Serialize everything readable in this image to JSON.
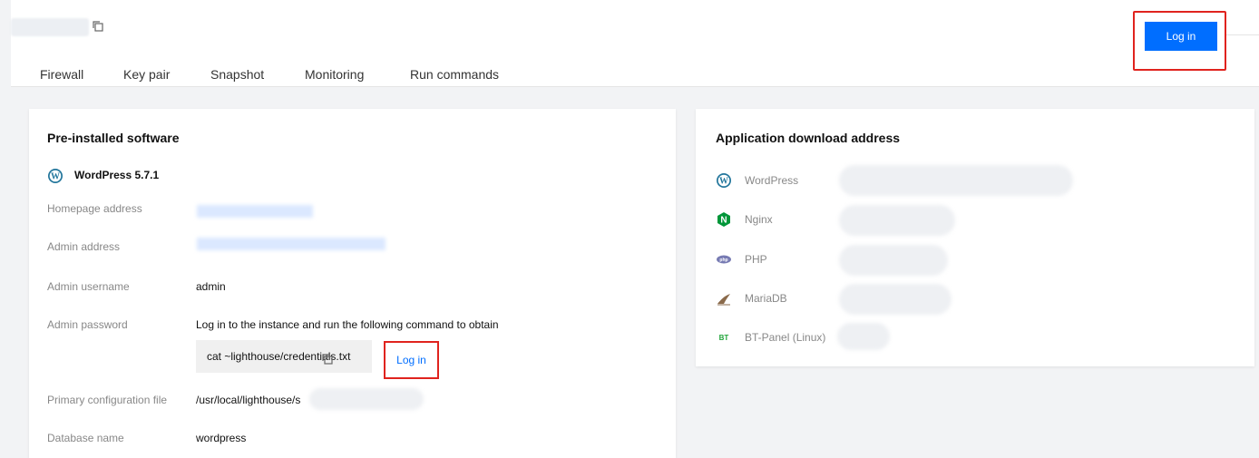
{
  "tabs": [
    "Firewall",
    "Key pair",
    "Snapshot",
    "Monitoring",
    "Run commands"
  ],
  "header": {
    "login_label": "Log in"
  },
  "left_card": {
    "title": "Pre-installed software",
    "software_name": "WordPress 5.7.1",
    "rows": {
      "homepage_label": "Homepage address",
      "admin_address_label": "Admin address",
      "admin_username_label": "Admin username",
      "admin_username_value": "admin",
      "admin_password_label": "Admin password",
      "admin_password_hint": "Log in to the instance and run the following command to obtain",
      "command": "cat ~lighthouse/credentials.txt",
      "login_label": "Log in",
      "config_label": "Primary configuration file",
      "config_value": "/usr/local/lighthouse/s",
      "db_label": "Database name",
      "db_value": "wordpress"
    }
  },
  "right_card": {
    "title": "Application download address",
    "apps": [
      "WordPress",
      "Nginx",
      "PHP",
      "MariaDB",
      "BT-Panel (Linux)"
    ]
  },
  "colors": {
    "primary": "#006eff",
    "highlight": "#e0231e",
    "nginx": "#009639"
  },
  "icons": {
    "wordpress": "wordpress-icon",
    "nginx": "nginx-icon",
    "php": "php-icon",
    "mariadb": "mariadb-icon",
    "btpanel": "bt-panel-icon",
    "copy": "copy-icon"
  }
}
